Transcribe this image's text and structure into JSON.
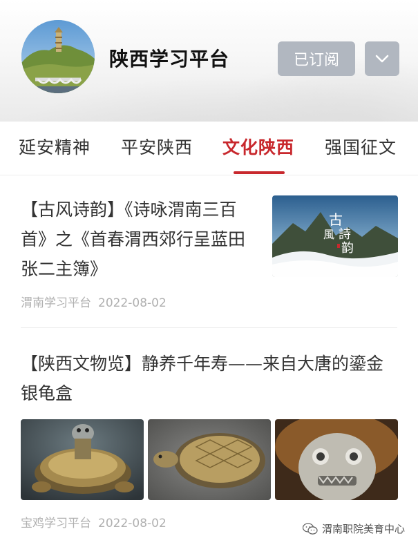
{
  "header": {
    "channel_title": "陕西学习平台",
    "subscribed_label": "已订阅",
    "dropdown_icon": "chevron-down-icon"
  },
  "tabs": [
    {
      "label": "延安精神",
      "active": false
    },
    {
      "label": "平安陕西",
      "active": false
    },
    {
      "label": "文化陕西",
      "active": true
    },
    {
      "label": "强国征文",
      "active": false
    }
  ],
  "articles": [
    {
      "title": "【古风诗韵】《诗咏渭南三百首》之《首春渭西郊行呈蓝田张二主簿》",
      "source": "渭南学习平台",
      "date": "2022-08-02",
      "thumb_text": "古風詩韵"
    },
    {
      "title": "【陕西文物览】静养千年寿——来自大唐的鎏金银龟盒",
      "source": "宝鸡学习平台",
      "date": "2022-08-02"
    }
  ],
  "watermark": {
    "text": "渭南职院美育中心",
    "icon": "wechat-icon"
  },
  "colors": {
    "accent": "#c8282d",
    "button_bg": "#b1b7c0",
    "meta_text": "#b0b0b0"
  }
}
